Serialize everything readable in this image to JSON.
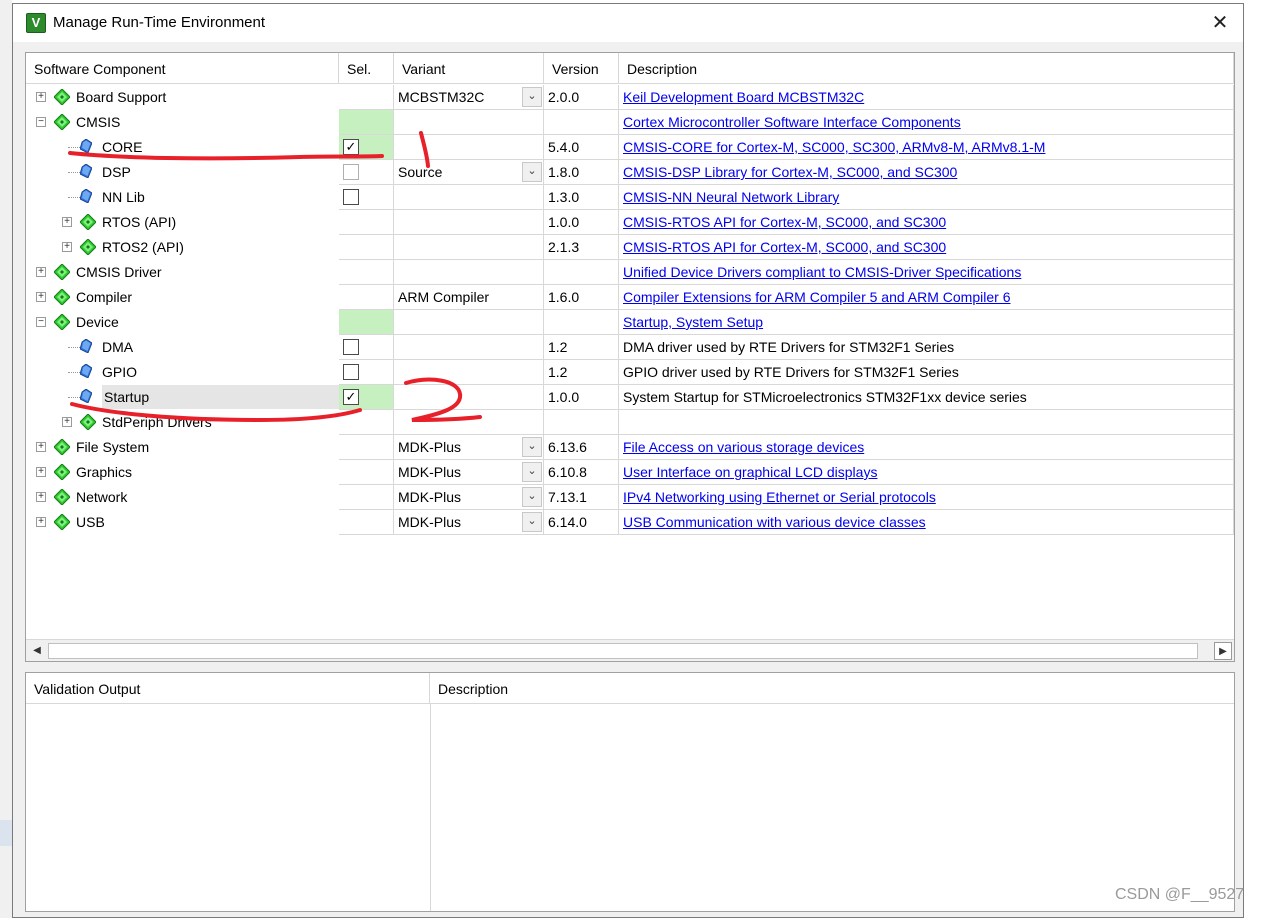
{
  "window": {
    "title": "Manage Run-Time Environment",
    "icon_letter": "V",
    "close_glyph": "✕"
  },
  "columns": {
    "component": "Software Component",
    "sel": "Sel.",
    "variant": "Variant",
    "version": "Version",
    "description": "Description"
  },
  "rows": [
    {
      "name": "Board Support",
      "variant": "MCBSTM32C",
      "version": "2.0.0",
      "description": "Keil Development Board MCBSTM32C"
    },
    {
      "name": "CMSIS",
      "variant": "",
      "version": "",
      "description": "Cortex Microcontroller Software Interface Components"
    },
    {
      "name": "CORE",
      "variant": "",
      "version": "5.4.0",
      "description": "CMSIS-CORE for Cortex-M, SC000, SC300, ARMv8-M, ARMv8.1-M",
      "checked": true
    },
    {
      "name": "DSP",
      "variant": "Source",
      "version": "1.8.0",
      "description": "CMSIS-DSP Library for Cortex-M, SC000, and SC300",
      "checked": false
    },
    {
      "name": "NN Lib",
      "variant": "",
      "version": "1.3.0",
      "description": "CMSIS-NN Neural Network Library",
      "checked": false
    },
    {
      "name": "RTOS (API)",
      "variant": "",
      "version": "1.0.0",
      "description": "CMSIS-RTOS API for Cortex-M, SC000, and SC300"
    },
    {
      "name": "RTOS2 (API)",
      "variant": "",
      "version": "2.1.3",
      "description": "CMSIS-RTOS API for Cortex-M, SC000, and SC300"
    },
    {
      "name": "CMSIS Driver",
      "variant": "",
      "version": "",
      "description": "Unified Device Drivers compliant to CMSIS-Driver Specifications"
    },
    {
      "name": "Compiler",
      "variant": "ARM Compiler",
      "version": "1.6.0",
      "description": "Compiler Extensions for ARM Compiler 5 and ARM Compiler 6"
    },
    {
      "name": "Device",
      "variant": "",
      "version": "",
      "description": "Startup, System Setup"
    },
    {
      "name": "DMA",
      "variant": "",
      "version": "1.2",
      "description": "DMA driver used by RTE Drivers for STM32F1 Series",
      "checked": false
    },
    {
      "name": "GPIO",
      "variant": "",
      "version": "1.2",
      "description": "GPIO driver used by RTE Drivers for STM32F1 Series",
      "checked": false
    },
    {
      "name": "Startup",
      "variant": "",
      "version": "1.0.0",
      "description": "System Startup for STMicroelectronics STM32F1xx device series",
      "checked": true
    },
    {
      "name": "StdPeriph Drivers",
      "variant": "",
      "version": "",
      "description": ""
    },
    {
      "name": "File System",
      "variant": "MDK-Plus",
      "version": "6.13.6",
      "description": "File Access on various storage devices"
    },
    {
      "name": "Graphics",
      "variant": "MDK-Plus",
      "version": "6.10.8",
      "description": "User Interface on graphical LCD displays"
    },
    {
      "name": "Network",
      "variant": "MDK-Plus",
      "version": "7.13.1",
      "description": "IPv4 Networking using Ethernet or Serial protocols"
    },
    {
      "name": "USB",
      "variant": "MDK-Plus",
      "version": "6.14.0",
      "description": "USB Communication with various device classes"
    }
  ],
  "validation": {
    "output_header": "Validation Output",
    "description_header": "Description"
  },
  "annotations": {
    "mark1": "1",
    "mark2": "2"
  },
  "watermark": "CSDN @F__9527",
  "colors": {
    "link": "#0000ee",
    "sel_green": "#c6f0c0",
    "annotation_red": "#e8202a",
    "gem_green": "#2ecc2e"
  },
  "icons": {
    "expander_plus": "⊞",
    "expander_minus": "⊟",
    "dropdown": "⌄",
    "check": "✓",
    "scroll_left": "◀",
    "scroll_right": "▶"
  }
}
